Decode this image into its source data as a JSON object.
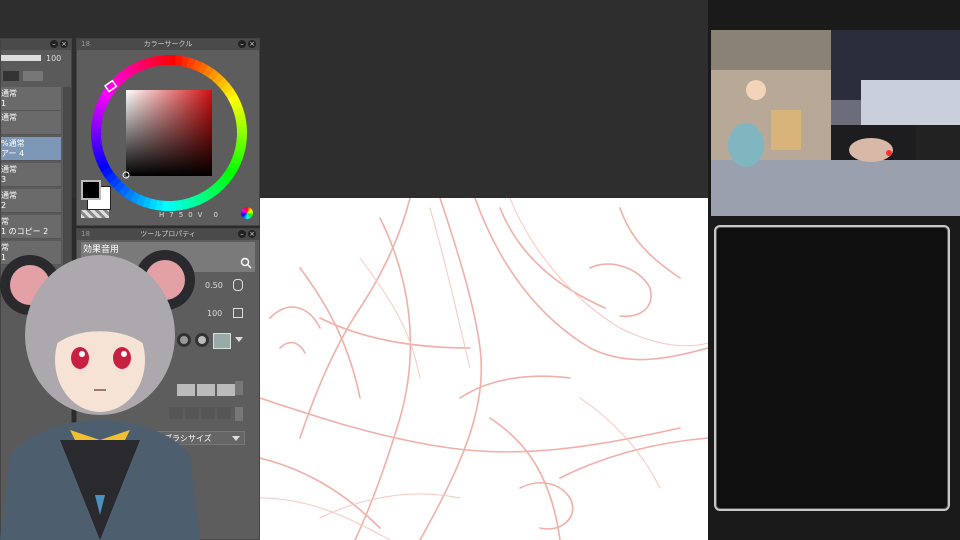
{
  "top_bar": {
    "opacity_value": "100"
  },
  "layer_panel": {
    "items": [
      {
        "mode": "通常",
        "name": "1"
      },
      {
        "mode": "通常",
        "name": ""
      },
      {
        "mode": "%通常",
        "name": "アー 4"
      },
      {
        "mode": "通常",
        "name": "3"
      },
      {
        "mode": "通常",
        "name": "2"
      },
      {
        "mode": "常",
        "name": "1 のコピー 2"
      },
      {
        "mode": "常",
        "name": "1"
      }
    ]
  },
  "color_circle": {
    "title": "カラーサークル",
    "num": "18",
    "hsv": {
      "h_label": "H",
      "h_value": "7",
      "s_value": "5",
      "v_label": "V",
      "v_value": "0",
      "end_value": "0"
    },
    "main_color": "#000000",
    "sub_color": "#ffffff",
    "hue_color": "#d01010"
  },
  "tool_property": {
    "title": "ツールプロパティ",
    "num": "18",
    "tool_name": "効果音用",
    "size_value": "0.50",
    "density_value": "100",
    "brush_size_label": "ブラシサイズ"
  },
  "colors": {
    "sketch_stroke": "#f0a8a0",
    "panel_bg": "#5d5d5d",
    "selected_layer": "#7c98b6"
  }
}
